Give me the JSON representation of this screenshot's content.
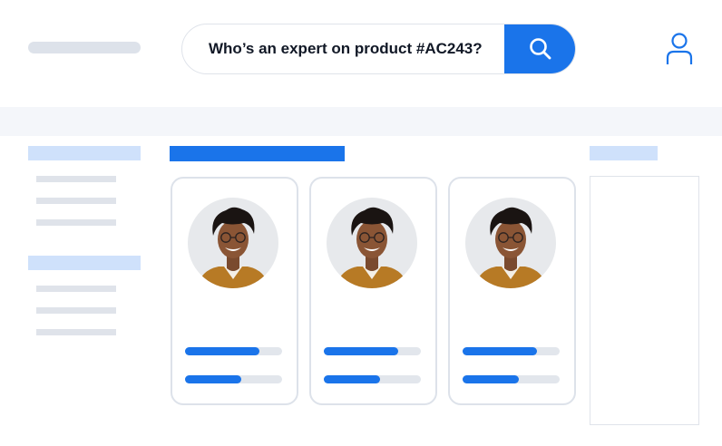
{
  "search": {
    "query": "Who’s an expert on product #AC243?"
  },
  "header": {
    "search_button_icon": "search-icon",
    "profile_icon": "user-icon"
  },
  "colors": {
    "accent": "#1a74ea",
    "light_accent": "#cfe1fb",
    "placeholder": "#dfe3ea",
    "band": "#f4f6fa"
  },
  "experts": [
    {
      "skill_levels": [
        0.77,
        0.58
      ]
    },
    {
      "skill_levels": [
        0.77,
        0.58
      ]
    },
    {
      "skill_levels": [
        0.77,
        0.58
      ]
    }
  ]
}
